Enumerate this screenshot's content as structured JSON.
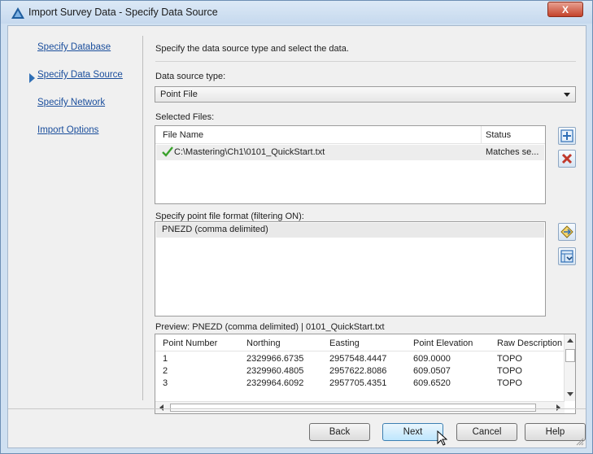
{
  "window": {
    "title": "Import Survey Data - Specify Data Source",
    "close_label": "X"
  },
  "nav": {
    "items": [
      {
        "label": "Specify Database"
      },
      {
        "label": "Specify Data Source"
      },
      {
        "label": "Specify Network"
      },
      {
        "label": "Import Options"
      }
    ],
    "current_index": 1
  },
  "main": {
    "instruction": "Specify the data source type and select the data.",
    "source_type_label": "Data source type:",
    "source_type_value": "Point File",
    "selected_files_label": "Selected Files:",
    "files_table": {
      "columns": [
        "File Name",
        "Status"
      ],
      "rows": [
        {
          "file": "C:\\Mastering\\Ch1\\0101_QuickStart.txt",
          "status": "Matches se..."
        }
      ]
    },
    "format_label": "Specify point file format (filtering ON):",
    "formats": [
      "PNEZD (comma delimited)"
    ],
    "preview_label": "Preview: PNEZD (comma delimited) | 0101_QuickStart.txt",
    "preview_table": {
      "columns": [
        "Point Number",
        "Northing",
        "Easting",
        "Point Elevation",
        "Raw Description"
      ],
      "rows": [
        [
          "1",
          "2329966.6735",
          "2957548.4447",
          "609.0000",
          "TOPO"
        ],
        [
          "2",
          "2329960.4805",
          "2957622.8086",
          "609.0507",
          "TOPO"
        ],
        [
          "3",
          "2329964.6092",
          "2957705.4351",
          "609.6520",
          "TOPO"
        ]
      ]
    }
  },
  "buttons": {
    "back": "Back",
    "next": "Next",
    "cancel": "Cancel",
    "help": "Help"
  },
  "colors": {
    "link": "#1a4e9c",
    "accent": "#2f6fb6",
    "remove": "#c0392b",
    "check": "#3aa12c"
  }
}
